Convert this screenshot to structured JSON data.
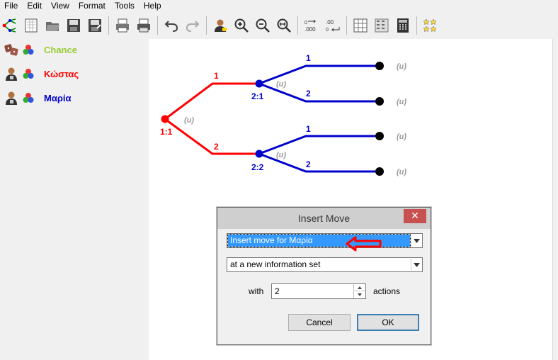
{
  "menu": [
    "File",
    "Edit",
    "View",
    "Format",
    "Tools",
    "Help"
  ],
  "toolbar": {
    "buttons": [
      "tree-logo-icon",
      "new-document-icon",
      "open-folder-icon",
      "save-icon",
      "save-as-icon",
      "print-preview-icon",
      "print-icon",
      "undo-icon",
      "redo-icon",
      "add-player-icon",
      "zoom-in-icon",
      "zoom-out-icon",
      "zoom-fit-icon",
      "increase-decimals-icon",
      "decrease-decimals-icon",
      "table-view-icon",
      "matrix-view-icon",
      "calculator-icon",
      "stars-icon"
    ]
  },
  "players": [
    {
      "name": "Chance",
      "color": "#99cc33",
      "icon": "chance-dice-icon"
    },
    {
      "name": "Κώστας",
      "color": "#ff0000",
      "icon": "player-person-icon"
    },
    {
      "name": "Μαρία",
      "color": "#0000cc",
      "icon": "player-person-icon"
    }
  ],
  "tree": {
    "root_label": "1:1",
    "root_payoff": "(u)",
    "player1_actions": [
      "1",
      "2"
    ],
    "node_2_1": "2:1",
    "node_2_2": "2:2",
    "node_payoff": "(u)",
    "player2_actions": [
      "1",
      "2",
      "1",
      "2"
    ],
    "terminal_payoffs": [
      "(u)",
      "(u)",
      "(u)",
      "(u)"
    ],
    "colors": {
      "player1": "#ff0000",
      "player2": "#0000cc",
      "terminal": "#000000",
      "payoff": "#999999"
    }
  },
  "dialog": {
    "title": "Insert Move",
    "close_glyph": "✕",
    "player_select": "Insert move for Μαρία",
    "infoset_select": "at a new information set",
    "with_label": "with",
    "actions_value": "2",
    "actions_label": "actions",
    "cancel_label": "Cancel",
    "ok_label": "OK",
    "arrow_color": "#ff0000"
  }
}
